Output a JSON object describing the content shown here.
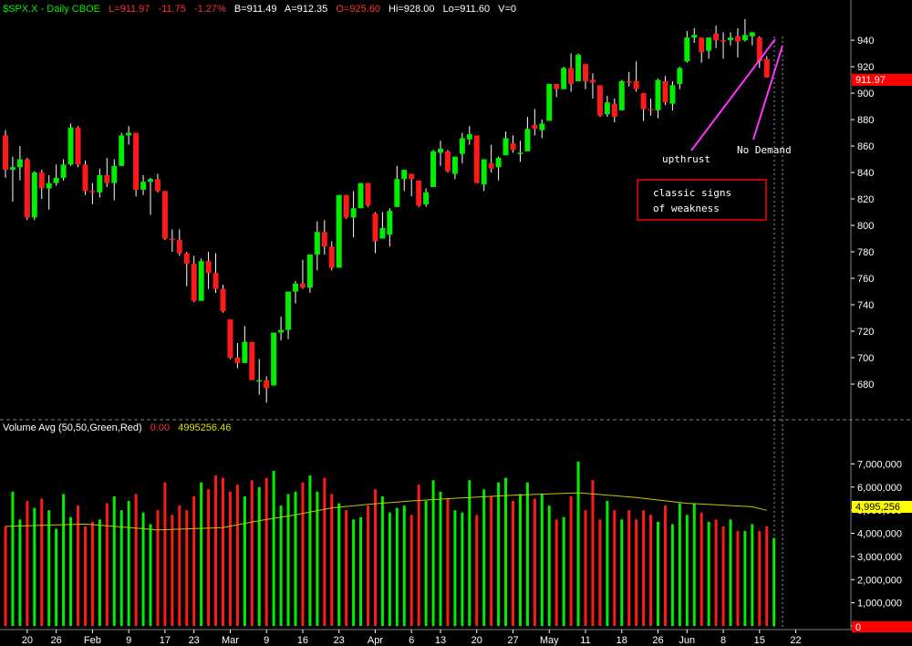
{
  "header": {
    "symbol": "$SPX.X - Daily CBOE",
    "last": "L=911.97",
    "change": "-11.75",
    "pct": "-1.27%",
    "bid": "B=911.49",
    "ask": "A=912.35",
    "open": "O=925.60",
    "high": "Hi=928.00",
    "low": "Lo=911.60",
    "vol": "V=0"
  },
  "volume_header": {
    "label": "Volume Avg (50,50,Green,Red)",
    "value1": "0.00",
    "value2": "4995256.46"
  },
  "price_badge": "911.97",
  "volume_badge": "4,995,256",
  "volume_zero_badge": "0",
  "annotations": {
    "upthrust": "upthrust",
    "no_demand": "No Demand",
    "box_line1": "classic signs",
    "box_line2": "of weakness"
  },
  "colors": {
    "up": "#00ee00",
    "down": "#ff1a1a",
    "avg_line": "#c8c800",
    "annotation_line": "#ff33ff",
    "box_border": "#ff0000",
    "badge": "#ff0000",
    "badge_yellow": "#ffff00"
  },
  "chart_data": [
    {
      "type": "candlestick",
      "title": "$SPX.X - Daily CBOE",
      "ylim": [
        660,
        958
      ],
      "y_ticks": [
        680,
        700,
        720,
        740,
        760,
        780,
        800,
        820,
        840,
        860,
        880,
        900,
        920,
        940
      ],
      "x_labels": [
        "20",
        "26",
        "Feb",
        "9",
        "17",
        "23",
        "Mar",
        "9",
        "16",
        "23",
        "Apr",
        "6",
        "13",
        "20",
        "27",
        "May",
        "11",
        "18",
        "26",
        "Jun",
        "8",
        "15",
        "22"
      ],
      "x_label_dates": [
        "2009-01-20",
        "2009-01-26",
        "2009-02-02",
        "2009-02-09",
        "2009-02-17",
        "2009-02-23",
        "2009-03-02",
        "2009-03-09",
        "2009-03-16",
        "2009-03-23",
        "2009-03-30",
        "2009-04-06",
        "2009-04-13",
        "2009-04-20",
        "2009-04-27",
        "2009-05-04",
        "2009-05-11",
        "2009-05-18",
        "2009-05-26",
        "2009-06-01",
        "2009-06-08",
        "2009-06-15",
        "2009-06-22"
      ],
      "candles": [
        {
          "date": "2009-01-14",
          "o": 868,
          "h": 872,
          "l": 836,
          "c": 842
        },
        {
          "date": "2009-01-15",
          "o": 842,
          "h": 852,
          "l": 818,
          "c": 844
        },
        {
          "date": "2009-01-16",
          "o": 844,
          "h": 860,
          "l": 834,
          "c": 850
        },
        {
          "date": "2009-01-20",
          "o": 850,
          "h": 851,
          "l": 804,
          "c": 806
        },
        {
          "date": "2009-01-21",
          "o": 806,
          "h": 841,
          "l": 804,
          "c": 840
        },
        {
          "date": "2009-01-22",
          "o": 840,
          "h": 842,
          "l": 820,
          "c": 828
        },
        {
          "date": "2009-01-23",
          "o": 828,
          "h": 838,
          "l": 812,
          "c": 832
        },
        {
          "date": "2009-01-26",
          "o": 832,
          "h": 846,
          "l": 830,
          "c": 836
        },
        {
          "date": "2009-01-27",
          "o": 836,
          "h": 850,
          "l": 834,
          "c": 846
        },
        {
          "date": "2009-01-28",
          "o": 846,
          "h": 877,
          "l": 845,
          "c": 874
        },
        {
          "date": "2009-01-29",
          "o": 874,
          "h": 875,
          "l": 844,
          "c": 846
        },
        {
          "date": "2009-01-30",
          "o": 846,
          "h": 849,
          "l": 823,
          "c": 826
        },
        {
          "date": "2009-02-02",
          "o": 826,
          "h": 832,
          "l": 816,
          "c": 825
        },
        {
          "date": "2009-02-03",
          "o": 825,
          "h": 843,
          "l": 821,
          "c": 838
        },
        {
          "date": "2009-02-04",
          "o": 838,
          "h": 851,
          "l": 829,
          "c": 832
        },
        {
          "date": "2009-02-05",
          "o": 832,
          "h": 850,
          "l": 819,
          "c": 845
        },
        {
          "date": "2009-02-06",
          "o": 845,
          "h": 870,
          "l": 845,
          "c": 868
        },
        {
          "date": "2009-02-09",
          "o": 868,
          "h": 875,
          "l": 861,
          "c": 870
        },
        {
          "date": "2009-02-10",
          "o": 870,
          "h": 869,
          "l": 822,
          "c": 827
        },
        {
          "date": "2009-02-11",
          "o": 827,
          "h": 838,
          "l": 823,
          "c": 833
        },
        {
          "date": "2009-02-12",
          "o": 833,
          "h": 836,
          "l": 808,
          "c": 835
        },
        {
          "date": "2009-02-13",
          "o": 835,
          "h": 839,
          "l": 825,
          "c": 826
        },
        {
          "date": "2009-02-17",
          "o": 826,
          "h": 826,
          "l": 789,
          "c": 790
        },
        {
          "date": "2009-02-18",
          "o": 790,
          "h": 797,
          "l": 780,
          "c": 789
        },
        {
          "date": "2009-02-19",
          "o": 789,
          "h": 797,
          "l": 777,
          "c": 779
        },
        {
          "date": "2009-02-20",
          "o": 779,
          "h": 780,
          "l": 754,
          "c": 771
        },
        {
          "date": "2009-02-23",
          "o": 771,
          "h": 777,
          "l": 742,
          "c": 743
        },
        {
          "date": "2009-02-24",
          "o": 743,
          "h": 775,
          "l": 743,
          "c": 773
        },
        {
          "date": "2009-02-25",
          "o": 773,
          "h": 780,
          "l": 752,
          "c": 764
        },
        {
          "date": "2009-02-26",
          "o": 764,
          "h": 779,
          "l": 749,
          "c": 752
        },
        {
          "date": "2009-02-27",
          "o": 752,
          "h": 755,
          "l": 734,
          "c": 735
        },
        {
          "date": "2009-03-02",
          "o": 729,
          "h": 729,
          "l": 699,
          "c": 700
        },
        {
          "date": "2009-03-03",
          "o": 700,
          "h": 711,
          "l": 692,
          "c": 696
        },
        {
          "date": "2009-03-04",
          "o": 696,
          "h": 724,
          "l": 696,
          "c": 712
        },
        {
          "date": "2009-03-05",
          "o": 712,
          "h": 712,
          "l": 684,
          "c": 683
        },
        {
          "date": "2009-03-06",
          "o": 683,
          "h": 699,
          "l": 672,
          "c": 683
        },
        {
          "date": "2009-03-09",
          "o": 683,
          "h": 686,
          "l": 666,
          "c": 677
        },
        {
          "date": "2009-03-10",
          "o": 679,
          "h": 719,
          "l": 679,
          "c": 719
        },
        {
          "date": "2009-03-11",
          "o": 719,
          "h": 731,
          "l": 713,
          "c": 721
        },
        {
          "date": "2009-03-12",
          "o": 721,
          "h": 750,
          "l": 714,
          "c": 750
        },
        {
          "date": "2009-03-13",
          "o": 750,
          "h": 758,
          "l": 741,
          "c": 756
        },
        {
          "date": "2009-03-16",
          "o": 756,
          "h": 774,
          "l": 752,
          "c": 753
        },
        {
          "date": "2009-03-17",
          "o": 753,
          "h": 778,
          "l": 749,
          "c": 778
        },
        {
          "date": "2009-03-18",
          "o": 778,
          "h": 803,
          "l": 766,
          "c": 795
        },
        {
          "date": "2009-03-19",
          "o": 795,
          "h": 804,
          "l": 778,
          "c": 784
        },
        {
          "date": "2009-03-20",
          "o": 784,
          "h": 788,
          "l": 766,
          "c": 768
        },
        {
          "date": "2009-03-23",
          "o": 768,
          "h": 823,
          "l": 768,
          "c": 823
        },
        {
          "date": "2009-03-24",
          "o": 823,
          "h": 823,
          "l": 805,
          "c": 806
        },
        {
          "date": "2009-03-25",
          "o": 806,
          "h": 826,
          "l": 791,
          "c": 813
        },
        {
          "date": "2009-03-26",
          "o": 813,
          "h": 832,
          "l": 813,
          "c": 832
        },
        {
          "date": "2009-03-27",
          "o": 832,
          "h": 832,
          "l": 814,
          "c": 815
        },
        {
          "date": "2009-03-30",
          "o": 809,
          "h": 810,
          "l": 779,
          "c": 788
        },
        {
          "date": "2009-03-31",
          "o": 790,
          "h": 810,
          "l": 790,
          "c": 798
        },
        {
          "date": "2009-04-01",
          "o": 793,
          "h": 813,
          "l": 784,
          "c": 811
        },
        {
          "date": "2009-04-02",
          "o": 814,
          "h": 845,
          "l": 814,
          "c": 835
        },
        {
          "date": "2009-04-03",
          "o": 835,
          "h": 842,
          "l": 826,
          "c": 842
        },
        {
          "date": "2009-04-06",
          "o": 839,
          "h": 839,
          "l": 822,
          "c": 835
        },
        {
          "date": "2009-04-07",
          "o": 834,
          "h": 834,
          "l": 814,
          "c": 815
        },
        {
          "date": "2009-04-08",
          "o": 816,
          "h": 828,
          "l": 814,
          "c": 825
        },
        {
          "date": "2009-04-09",
          "o": 829,
          "h": 857,
          "l": 829,
          "c": 856
        },
        {
          "date": "2009-04-13",
          "o": 855,
          "h": 864,
          "l": 845,
          "c": 858
        },
        {
          "date": "2009-04-14",
          "o": 856,
          "h": 857,
          "l": 840,
          "c": 841
        },
        {
          "date": "2009-04-15",
          "o": 839,
          "h": 852,
          "l": 835,
          "c": 852
        },
        {
          "date": "2009-04-16",
          "o": 854,
          "h": 870,
          "l": 847,
          "c": 866
        },
        {
          "date": "2009-04-17",
          "o": 865,
          "h": 875,
          "l": 861,
          "c": 869
        },
        {
          "date": "2009-04-20",
          "o": 868,
          "h": 868,
          "l": 832,
          "c": 832
        },
        {
          "date": "2009-04-21",
          "o": 831,
          "h": 850,
          "l": 826,
          "c": 850
        },
        {
          "date": "2009-04-22",
          "o": 847,
          "h": 861,
          "l": 840,
          "c": 843
        },
        {
          "date": "2009-04-23",
          "o": 844,
          "h": 852,
          "l": 834,
          "c": 851
        },
        {
          "date": "2009-04-24",
          "o": 853,
          "h": 871,
          "l": 853,
          "c": 866
        },
        {
          "date": "2009-04-27",
          "o": 862,
          "h": 868,
          "l": 855,
          "c": 857
        },
        {
          "date": "2009-04-28",
          "o": 854,
          "h": 864,
          "l": 848,
          "c": 855
        },
        {
          "date": "2009-04-29",
          "o": 856,
          "h": 882,
          "l": 856,
          "c": 873
        },
        {
          "date": "2009-04-30",
          "o": 876,
          "h": 888,
          "l": 868,
          "c": 873
        },
        {
          "date": "2009-05-01",
          "o": 872,
          "h": 880,
          "l": 866,
          "c": 877
        },
        {
          "date": "2009-05-04",
          "o": 879,
          "h": 907,
          "l": 879,
          "c": 907
        },
        {
          "date": "2009-05-05",
          "o": 907,
          "h": 907,
          "l": 897,
          "c": 903
        },
        {
          "date": "2009-05-06",
          "o": 903,
          "h": 920,
          "l": 903,
          "c": 919
        },
        {
          "date": "2009-05-07",
          "o": 919,
          "h": 930,
          "l": 901,
          "c": 907
        },
        {
          "date": "2009-05-08",
          "o": 909,
          "h": 930,
          "l": 909,
          "c": 929
        },
        {
          "date": "2009-05-11",
          "o": 922,
          "h": 922,
          "l": 903,
          "c": 909
        },
        {
          "date": "2009-05-12",
          "o": 910,
          "h": 915,
          "l": 896,
          "c": 908
        },
        {
          "date": "2009-05-13",
          "o": 906,
          "h": 906,
          "l": 882,
          "c": 883
        },
        {
          "date": "2009-05-14",
          "o": 884,
          "h": 898,
          "l": 882,
          "c": 893
        },
        {
          "date": "2009-05-15",
          "o": 892,
          "h": 896,
          "l": 878,
          "c": 882
        },
        {
          "date": "2009-05-18",
          "o": 887,
          "h": 910,
          "l": 887,
          "c": 909
        },
        {
          "date": "2009-05-19",
          "o": 909,
          "h": 916,
          "l": 905,
          "c": 908
        },
        {
          "date": "2009-05-20",
          "o": 909,
          "h": 924,
          "l": 901,
          "c": 903
        },
        {
          "date": "2009-05-21",
          "o": 900,
          "h": 900,
          "l": 879,
          "c": 888
        },
        {
          "date": "2009-05-22",
          "o": 888,
          "h": 896,
          "l": 883,
          "c": 887
        },
        {
          "date": "2009-05-26",
          "o": 887,
          "h": 911,
          "l": 881,
          "c": 910
        },
        {
          "date": "2009-05-27",
          "o": 909,
          "h": 913,
          "l": 891,
          "c": 893
        },
        {
          "date": "2009-05-28",
          "o": 892,
          "h": 909,
          "l": 887,
          "c": 906
        },
        {
          "date": "2009-05-29",
          "o": 907,
          "h": 920,
          "l": 903,
          "c": 919
        },
        {
          "date": "2009-06-01",
          "o": 924,
          "h": 947,
          "l": 923,
          "c": 942
        },
        {
          "date": "2009-06-02",
          "o": 942,
          "h": 949,
          "l": 938,
          "c": 944
        },
        {
          "date": "2009-06-03",
          "o": 942,
          "h": 942,
          "l": 923,
          "c": 931
        },
        {
          "date": "2009-06-04",
          "o": 932,
          "h": 942,
          "l": 926,
          "c": 942
        },
        {
          "date": "2009-06-05",
          "o": 945,
          "h": 951,
          "l": 934,
          "c": 940
        },
        {
          "date": "2009-06-08",
          "o": 940,
          "h": 946,
          "l": 926,
          "c": 939
        },
        {
          "date": "2009-06-09",
          "o": 940,
          "h": 946,
          "l": 936,
          "c": 942
        },
        {
          "date": "2009-06-10",
          "o": 943,
          "h": 949,
          "l": 927,
          "c": 939
        },
        {
          "date": "2009-06-11",
          "o": 940,
          "h": 956,
          "l": 939,
          "c": 944
        },
        {
          "date": "2009-06-12",
          "o": 943,
          "h": 946,
          "l": 936,
          "c": 946
        },
        {
          "date": "2009-06-15",
          "o": 942,
          "h": 943,
          "l": 919,
          "c": 924
        },
        {
          "date": "2009-06-16",
          "o": 925.6,
          "h": 928,
          "l": 911.6,
          "c": 911.97
        }
      ]
    },
    {
      "type": "bar",
      "title": "Volume Avg (50,50,Green,Red)",
      "ylim": [
        0,
        8200000
      ],
      "y_ticks": [
        "0",
        "1,000,000",
        "2,000,000",
        "3,000,000",
        "4,000,000",
        "5,000,000",
        "6,000,000",
        "7,000,000"
      ],
      "y_tick_values": [
        0,
        1000000,
        2000000,
        3000000,
        4000000,
        5000000,
        6000000,
        7000000
      ],
      "volumes": [
        4300000,
        5800000,
        4600000,
        5400000,
        5100000,
        5500000,
        5000000,
        4200000,
        5700000,
        4700000,
        5200000,
        4300000,
        4500000,
        4600000,
        5300000,
        5600000,
        5000000,
        5400000,
        5700000,
        4900000,
        4400000,
        5000000,
        6200000,
        4800000,
        5200000,
        5000000,
        5600000,
        6200000,
        5900000,
        6500000,
        6400000,
        5800000,
        6100000,
        5600000,
        6300000,
        6000000,
        6400000,
        6700000,
        5200000,
        5700000,
        5800000,
        6200000,
        6500000,
        5800000,
        6400000,
        5700000,
        5300000,
        5000000,
        4600000,
        4700000,
        5200000,
        5900000,
        5600000,
        4900000,
        5100000,
        5200000,
        4800000,
        6100000,
        5400000,
        6300000,
        5800000,
        5500000,
        5000000,
        4900000,
        6300000,
        4800000,
        5900000,
        5600000,
        6200000,
        6400000,
        5400000,
        5700000,
        6200000,
        5500000,
        5700000,
        5200000,
        4600000,
        4700000,
        5600000,
        7100000,
        5000000,
        6300000,
        4600000,
        5400000,
        5000000,
        4600000,
        5000000,
        4600000,
        5000000,
        4800000,
        4500000,
        5200000,
        4400000,
        5300000,
        4800000,
        5300000,
        4900000,
        4500000,
        4600000,
        4300000,
        4600000,
        4100000,
        4100000,
        4400000,
        4100000,
        4300000,
        3800000
      ],
      "avg_series": [
        {
          "date": "2009-01-14",
          "v": 4300000
        },
        {
          "date": "2009-01-30",
          "v": 4400000
        },
        {
          "date": "2009-02-13",
          "v": 4150000
        },
        {
          "date": "2009-02-27",
          "v": 4250000
        },
        {
          "date": "2009-03-06",
          "v": 4550000
        },
        {
          "date": "2009-03-13",
          "v": 4800000
        },
        {
          "date": "2009-03-20",
          "v": 5100000
        },
        {
          "date": "2009-03-27",
          "v": 5250000
        },
        {
          "date": "2009-04-06",
          "v": 5400000
        },
        {
          "date": "2009-04-17",
          "v": 5550000
        },
        {
          "date": "2009-04-27",
          "v": 5650000
        },
        {
          "date": "2009-05-08",
          "v": 5750000
        },
        {
          "date": "2009-05-20",
          "v": 5550000
        },
        {
          "date": "2009-06-01",
          "v": 5300000
        },
        {
          "date": "2009-06-12",
          "v": 5150000
        },
        {
          "date": "2009-06-16",
          "v": 4995256
        }
      ]
    }
  ]
}
